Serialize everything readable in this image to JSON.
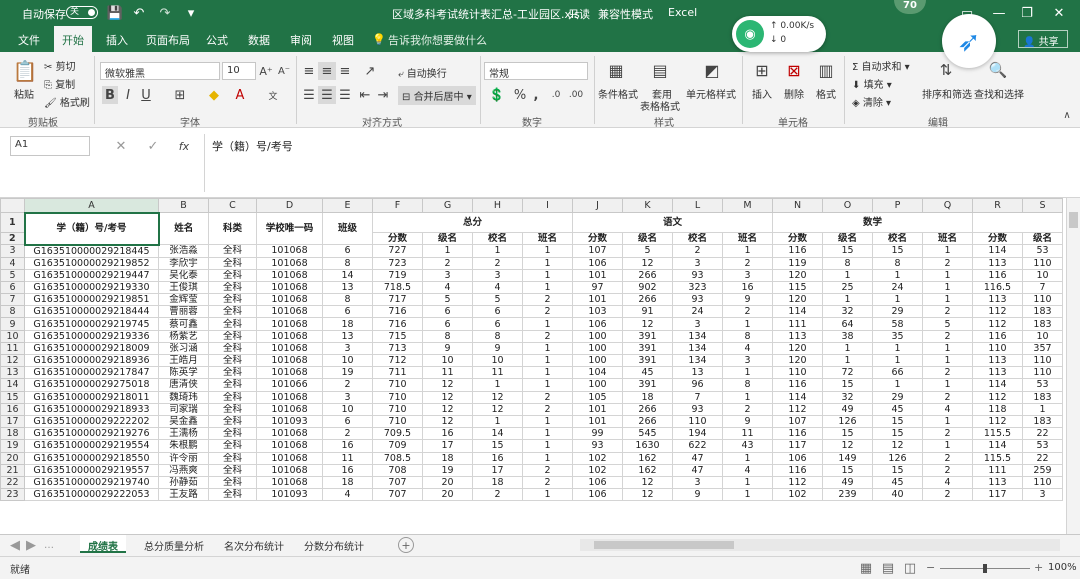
{
  "titlebar": {
    "autosave": "自动保存",
    "toggle": "关",
    "filename": "区域多科考试统计表汇总-工业园区.xls",
    "mode1": "只读",
    "mode2": "兼容性模式",
    "app": "Excel",
    "badge": "70"
  },
  "network": {
    "speed": "0.00K/s",
    "count": "0"
  },
  "tabs": [
    "文件",
    "开始",
    "插入",
    "页面布局",
    "公式",
    "数据",
    "审阅",
    "视图"
  ],
  "tell_me": "告诉我你想要做什么",
  "share": "共享",
  "ribbon": {
    "paste": "粘贴",
    "cut": "剪切",
    "copy": "复制",
    "format_painter": "格式刷",
    "clipboard": "剪贴板",
    "font_name": "微软雅黑",
    "font_size": "10",
    "font_group": "字体",
    "wrap": "自动换行",
    "merge": "合并后居中",
    "align_group": "对齐方式",
    "num_format": "常规",
    "num_group": "数字",
    "cond_format": "条件格式",
    "table_format1": "套用",
    "table_format2": "表格格式",
    "cell_style": "单元格样式",
    "style_group": "样式",
    "insert": "插入",
    "delete": "删除",
    "format": "格式",
    "cells_group": "单元格",
    "autosum": "自动求和",
    "fill": "填充",
    "clear": "清除",
    "sort": "排序和筛选",
    "find": "查找和选择",
    "edit_group": "编辑"
  },
  "formula_bar": {
    "cell_ref": "A1",
    "fx": "fx",
    "content": "学（籍）号/考号"
  },
  "columns": [
    "A",
    "B",
    "C",
    "D",
    "E",
    "F",
    "G",
    "H",
    "I",
    "J",
    "K",
    "L",
    "M",
    "N",
    "O",
    "P",
    "Q",
    "R",
    "S"
  ],
  "header1": {
    "id": "学（籍）号/考号",
    "name": "姓名",
    "subject": "科类",
    "school": "学校唯一码",
    "class": "班级",
    "total": "总分",
    "chinese": "语文",
    "math": "数学"
  },
  "header2": [
    "分数",
    "级名",
    "校名",
    "班名",
    "分数",
    "级名",
    "校名",
    "班名",
    "分数",
    "级名",
    "校名",
    "班名",
    "分数",
    "级名"
  ],
  "rows": [
    [
      "G163510000029218445",
      "张浩淼",
      "全科",
      "101068",
      "6",
      "727",
      "1",
      "1",
      "1",
      "107",
      "5",
      "2",
      "1",
      "116",
      "15",
      "15",
      "1",
      "114",
      "53"
    ],
    [
      "G163510000029219852",
      "李欣宇",
      "全科",
      "101068",
      "8",
      "723",
      "2",
      "2",
      "1",
      "106",
      "12",
      "3",
      "2",
      "119",
      "8",
      "8",
      "2",
      "113",
      "110"
    ],
    [
      "G163510000029219447",
      "吴化泰",
      "全科",
      "101068",
      "14",
      "719",
      "3",
      "3",
      "1",
      "101",
      "266",
      "93",
      "3",
      "120",
      "1",
      "1",
      "1",
      "116",
      "10"
    ],
    [
      "G163510000029219330",
      "王俊琪",
      "全科",
      "101068",
      "13",
      "718.5",
      "4",
      "4",
      "1",
      "97",
      "902",
      "323",
      "16",
      "115",
      "25",
      "24",
      "1",
      "116.5",
      "7"
    ],
    [
      "G163510000029219851",
      "金辉莹",
      "全科",
      "101068",
      "8",
      "717",
      "5",
      "5",
      "2",
      "101",
      "266",
      "93",
      "9",
      "120",
      "1",
      "1",
      "1",
      "113",
      "110"
    ],
    [
      "G163510000029218444",
      "曹丽蓉",
      "全科",
      "101068",
      "6",
      "716",
      "6",
      "6",
      "2",
      "103",
      "91",
      "24",
      "2",
      "114",
      "32",
      "29",
      "2",
      "112",
      "183"
    ],
    [
      "G163510000029219745",
      "蔡可鑫",
      "全科",
      "101068",
      "18",
      "716",
      "6",
      "6",
      "1",
      "106",
      "12",
      "3",
      "1",
      "111",
      "64",
      "58",
      "5",
      "112",
      "183"
    ],
    [
      "G163510000029219336",
      "杨紫艺",
      "全科",
      "101068",
      "13",
      "715",
      "8",
      "8",
      "2",
      "100",
      "391",
      "134",
      "8",
      "113",
      "38",
      "35",
      "2",
      "116",
      "10"
    ],
    [
      "G163510000029218009",
      "张习涵",
      "全科",
      "101068",
      "3",
      "713",
      "9",
      "9",
      "1",
      "100",
      "391",
      "134",
      "4",
      "120",
      "1",
      "1",
      "1",
      "110",
      "357"
    ],
    [
      "G163510000029218936",
      "王皓月",
      "全科",
      "101068",
      "10",
      "712",
      "10",
      "10",
      "1",
      "100",
      "391",
      "134",
      "3",
      "120",
      "1",
      "1",
      "1",
      "113",
      "110"
    ],
    [
      "G163510000029217847",
      "陈英学",
      "全科",
      "101068",
      "19",
      "711",
      "11",
      "11",
      "1",
      "104",
      "45",
      "13",
      "1",
      "110",
      "72",
      "66",
      "2",
      "113",
      "110"
    ],
    [
      "G163510000029275018",
      "唐清侠",
      "全科",
      "101066",
      "2",
      "710",
      "12",
      "1",
      "1",
      "100",
      "391",
      "96",
      "8",
      "116",
      "15",
      "1",
      "1",
      "114",
      "53"
    ],
    [
      "G163510000029218011",
      "魏琦玮",
      "全科",
      "101068",
      "3",
      "710",
      "12",
      "12",
      "2",
      "105",
      "18",
      "7",
      "1",
      "114",
      "32",
      "29",
      "2",
      "112",
      "183"
    ],
    [
      "G163510000029218933",
      "司家瑞",
      "全科",
      "101068",
      "10",
      "710",
      "12",
      "12",
      "2",
      "101",
      "266",
      "93",
      "2",
      "112",
      "49",
      "45",
      "4",
      "118",
      "1"
    ],
    [
      "G163510000029222202",
      "吴金鑫",
      "全科",
      "101093",
      "6",
      "710",
      "12",
      "1",
      "1",
      "101",
      "266",
      "110",
      "9",
      "107",
      "126",
      "15",
      "1",
      "112",
      "183"
    ],
    [
      "G163510000029219276",
      "王濡杨",
      "全科",
      "101068",
      "2",
      "709.5",
      "16",
      "14",
      "1",
      "99",
      "545",
      "194",
      "11",
      "116",
      "15",
      "15",
      "2",
      "115.5",
      "22"
    ],
    [
      "G163510000029219554",
      "朱根鹏",
      "全科",
      "101068",
      "16",
      "709",
      "17",
      "15",
      "1",
      "93",
      "1630",
      "622",
      "43",
      "117",
      "12",
      "12",
      "1",
      "114",
      "53"
    ],
    [
      "G163510000029218550",
      "许令丽",
      "全科",
      "101068",
      "11",
      "708.5",
      "18",
      "16",
      "1",
      "102",
      "162",
      "47",
      "1",
      "106",
      "149",
      "126",
      "2",
      "115.5",
      "22"
    ],
    [
      "G163510000029219557",
      "冯燕爽",
      "全科",
      "101068",
      "16",
      "708",
      "19",
      "17",
      "2",
      "102",
      "162",
      "47",
      "4",
      "116",
      "15",
      "15",
      "2",
      "111",
      "259"
    ],
    [
      "G163510000029219740",
      "孙静茹",
      "全科",
      "101068",
      "18",
      "707",
      "20",
      "18",
      "2",
      "106",
      "12",
      "3",
      "1",
      "112",
      "49",
      "45",
      "4",
      "113",
      "110"
    ],
    [
      "G163510000029222053",
      "王友路",
      "全科",
      "101093",
      "4",
      "707",
      "20",
      "2",
      "1",
      "106",
      "12",
      "9",
      "1",
      "102",
      "239",
      "40",
      "2",
      "117",
      "3"
    ]
  ],
  "sheets": [
    "成绩表",
    "总分质量分析",
    "名次分布统计",
    "分数分布统计"
  ],
  "status": {
    "ready": "就绪",
    "zoom": "100%"
  }
}
